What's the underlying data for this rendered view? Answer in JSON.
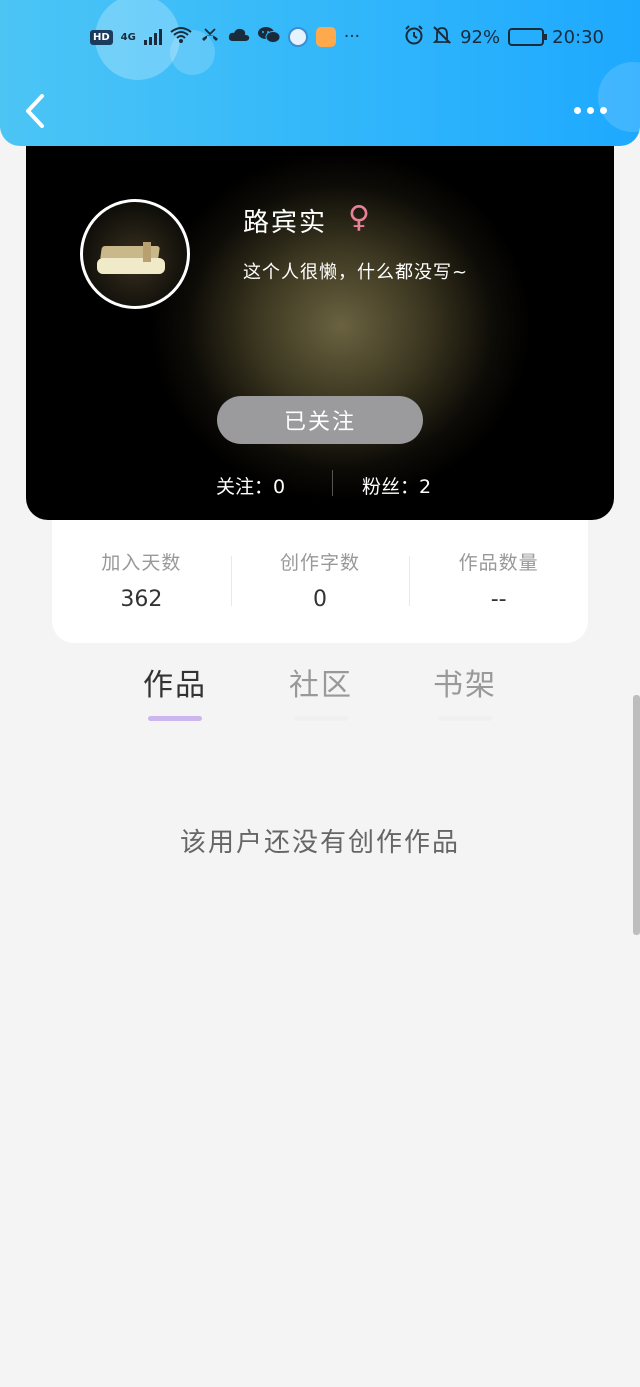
{
  "status_bar": {
    "hd": "HD",
    "network": "4G",
    "battery_percent": "92%",
    "battery_level": 0.92,
    "time": "20:30",
    "icons": [
      "signal-icon",
      "wifi-icon",
      "missed-call-icon",
      "cloud-icon",
      "wechat-icon",
      "browser-icon",
      "app-icon",
      "more-notifications-icon",
      "alarm-icon",
      "mute-icon",
      "battery-icon"
    ]
  },
  "header": {
    "back_icon": "chevron-left-icon",
    "more_icon": "more-dots-icon"
  },
  "profile": {
    "name": "路宾实",
    "gender_symbol": "♀",
    "bio": "这个人很懒，什么都没写~",
    "follow_button": "已关注",
    "following": "关注：0",
    "fans": "粉丝：2"
  },
  "stats": [
    {
      "label": "加入天数",
      "value": "362"
    },
    {
      "label": "创作字数",
      "value": "0"
    },
    {
      "label": "作品数量",
      "value": "--"
    }
  ],
  "tabs": [
    {
      "label": "作品",
      "active": true
    },
    {
      "label": "社区",
      "active": false
    },
    {
      "label": "书架",
      "active": false
    }
  ],
  "empty_message": "该用户还没有创作作品",
  "colors": {
    "header_gradient_start": "#4cc5f5",
    "header_gradient_end": "#1ea9ff",
    "gender_pink": "#e8809a",
    "tab_active_underline": "#cbb6ee",
    "follow_button_bg": "#9b9a9c"
  }
}
